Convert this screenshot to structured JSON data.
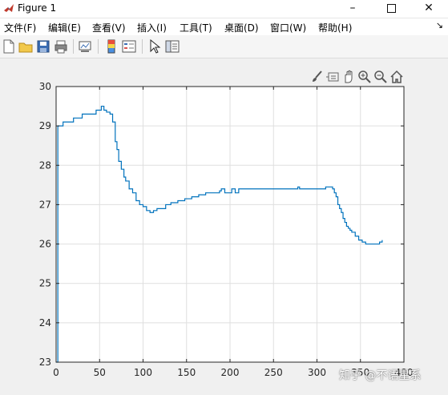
{
  "window": {
    "title": "Figure 1",
    "minimize_glyph": "–",
    "close_glyph": "✕"
  },
  "menu": {
    "items": [
      "文件(F)",
      "编辑(E)",
      "查看(V)",
      "插入(I)",
      "工具(T)",
      "桌面(D)",
      "窗口(W)",
      "帮助(H)"
    ],
    "more_glyph": "↘"
  },
  "toolbar": {
    "buttons": [
      "new-figure-icon",
      "open-file-icon",
      "save-icon",
      "print-icon",
      "link-plot-icon",
      "colorbar-icon",
      "legend-icon",
      "edit-plot-pointer-icon",
      "property-inspector-icon"
    ]
  },
  "axes_toolbar": {
    "buttons": [
      "brush-icon",
      "data-tips-icon",
      "pan-hand-icon",
      "zoom-in-icon",
      "zoom-out-icon",
      "restore-view-icon"
    ]
  },
  "watermark": "知乎 @不语星系",
  "colors": {
    "line": "#0072bd",
    "grid": "#dfdfdf",
    "axis": "#262626",
    "plot_bg": "#ffffff"
  },
  "chart_data": {
    "type": "line",
    "title": "",
    "xlabel": "",
    "ylabel": "",
    "xlim": [
      0,
      400
    ],
    "ylim": [
      23,
      30
    ],
    "xticks": [
      0,
      50,
      100,
      150,
      200,
      250,
      300,
      350,
      400
    ],
    "yticks": [
      23,
      24,
      25,
      26,
      27,
      28,
      29,
      30
    ],
    "grid": true,
    "step": true,
    "series": [
      {
        "x": [
          0,
          2,
          3,
          8,
          12,
          20,
          30,
          40,
          46,
          50,
          52,
          55,
          58,
          62,
          65,
          68,
          70,
          72,
          75,
          78,
          80,
          84,
          88,
          92,
          96,
          100,
          104,
          108,
          112,
          116,
          120,
          126,
          132,
          140,
          148,
          156,
          164,
          172,
          180,
          188,
          190,
          194,
          200,
          202,
          206,
          210,
          220,
          240,
          260,
          270,
          275,
          278,
          280,
          290,
          300,
          310,
          314,
          318,
          320,
          322,
          324,
          326,
          328,
          330,
          332,
          334,
          336,
          338,
          340,
          344,
          348,
          352,
          356,
          360,
          364,
          368,
          372,
          375
        ],
        "y": [
          23.0,
          29.0,
          29.0,
          29.1,
          29.1,
          29.2,
          29.3,
          29.3,
          29.4,
          29.4,
          29.5,
          29.4,
          29.35,
          29.3,
          29.1,
          28.6,
          28.4,
          28.1,
          27.9,
          27.7,
          27.6,
          27.4,
          27.3,
          27.1,
          27.0,
          26.95,
          26.85,
          26.8,
          26.85,
          26.9,
          26.9,
          27.0,
          27.05,
          27.1,
          27.15,
          27.2,
          27.25,
          27.3,
          27.3,
          27.35,
          27.4,
          27.3,
          27.3,
          27.4,
          27.3,
          27.4,
          27.4,
          27.4,
          27.4,
          27.4,
          27.4,
          27.45,
          27.4,
          27.4,
          27.4,
          27.45,
          27.45,
          27.4,
          27.3,
          27.2,
          27.0,
          26.9,
          26.8,
          26.65,
          26.55,
          26.45,
          26.4,
          26.35,
          26.3,
          26.2,
          26.1,
          26.05,
          26.0,
          26.0,
          26.0,
          26.0,
          26.05,
          26.1
        ]
      }
    ]
  }
}
